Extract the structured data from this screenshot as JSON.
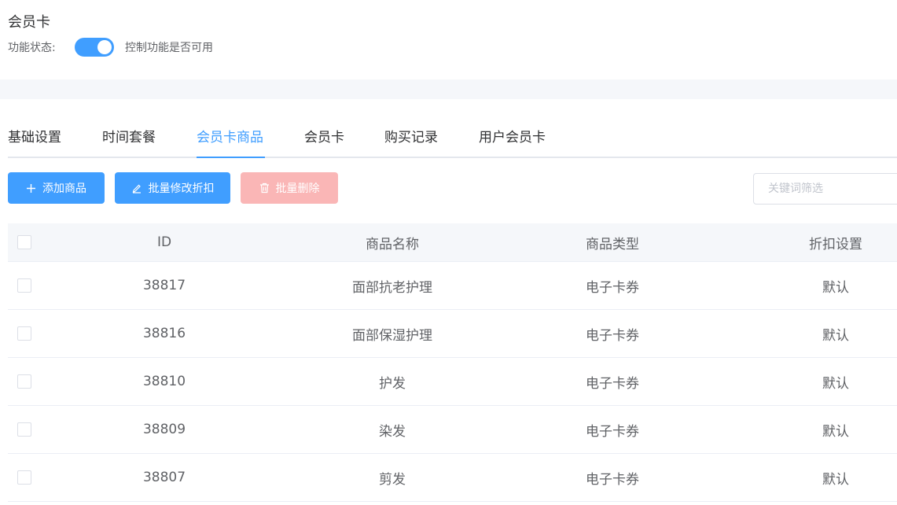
{
  "header": {
    "title": "会员卡",
    "status_label": "功能状态:",
    "status_enabled": true,
    "status_desc": "控制功能是否可用"
  },
  "tabs": [
    {
      "label": "基础设置",
      "active": false
    },
    {
      "label": "时间套餐",
      "active": false
    },
    {
      "label": "会员卡商品",
      "active": true
    },
    {
      "label": "会员卡",
      "active": false
    },
    {
      "label": "购买记录",
      "active": false
    },
    {
      "label": "用户会员卡",
      "active": false
    }
  ],
  "toolbar": {
    "add_label": "添加商品",
    "batch_discount_label": "批量修改折扣",
    "batch_delete_label": "批量删除",
    "search_placeholder": "关键词筛选"
  },
  "table": {
    "columns": [
      "ID",
      "商品名称",
      "商品类型",
      "折扣设置"
    ],
    "rows": [
      {
        "id": "38817",
        "name": "面部抗老护理",
        "type": "电子卡券",
        "discount": "默认"
      },
      {
        "id": "38816",
        "name": "面部保湿护理",
        "type": "电子卡券",
        "discount": "默认"
      },
      {
        "id": "38810",
        "name": "护发",
        "type": "电子卡券",
        "discount": "默认"
      },
      {
        "id": "38809",
        "name": "染发",
        "type": "电子卡券",
        "discount": "默认"
      },
      {
        "id": "38807",
        "name": "剪发",
        "type": "电子卡券",
        "discount": "默认"
      }
    ]
  },
  "colors": {
    "primary": "#409eff",
    "danger_disabled": "#fab6b6",
    "header_bg": "#f5f7fa"
  },
  "icons": {
    "add": "plus-icon",
    "batch_discount": "edit-icon",
    "batch_delete": "trash-icon"
  }
}
